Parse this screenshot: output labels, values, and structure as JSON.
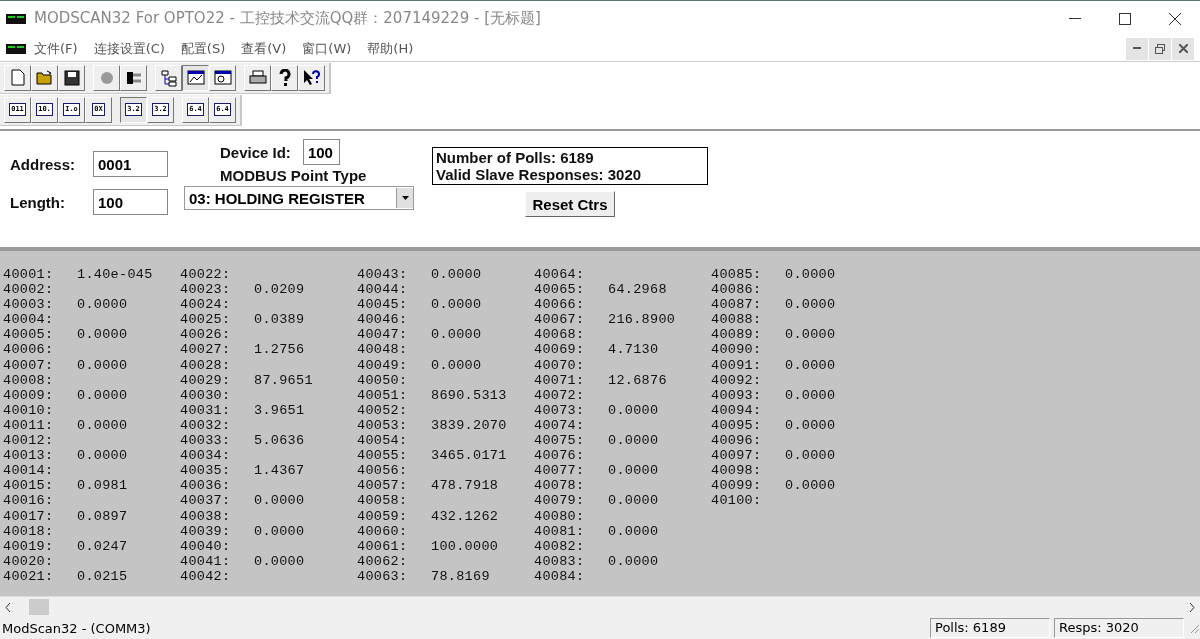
{
  "window": {
    "title": "MODSCAN32 For OPTO22 - 工控技术交流QQ群：207149229 - [无标题]"
  },
  "menu": [
    "文件(F)",
    "连接设置(C)",
    "配置(S)",
    "查看(V)",
    "窗口(W)",
    "帮助(H)"
  ],
  "toolbar": [
    [
      {
        "kind": "new",
        "pressed": false
      },
      {
        "kind": "open",
        "pressed": false
      },
      {
        "kind": "save",
        "pressed": false
      }
    ],
    [
      {
        "kind": "connect",
        "pressed": false
      },
      {
        "kind": "disconnect",
        "pressed": false
      }
    ],
    [
      {
        "kind": "tree",
        "pressed": false
      },
      {
        "kind": "chart",
        "pressed": true
      },
      {
        "kind": "display",
        "pressed": false
      }
    ],
    [
      {
        "kind": "print",
        "pressed": false
      },
      {
        "kind": "help",
        "pressed": false
      },
      {
        "kind": "context-help",
        "pressed": false
      }
    ]
  ],
  "format_bar": [
    [
      {
        "label": "011",
        "pressed": false
      },
      {
        "label": "10.",
        "pressed": false
      },
      {
        "label": "I.o",
        "pressed": false
      },
      {
        "label": "0X",
        "pressed": false
      }
    ],
    [
      {
        "label": "3.2",
        "pressed": true
      },
      {
        "label": "3.2",
        "pressed": false
      }
    ],
    [
      {
        "label": "6.4",
        "pressed": false
      },
      {
        "label": "6.4",
        "pressed": false
      }
    ]
  ],
  "form": {
    "address_label": "Address:",
    "address": "0001",
    "length_label": "Length:",
    "length": "100",
    "device_id_label": "Device Id:",
    "device_id": "100",
    "point_type_label": "MODBUS Point Type",
    "point_type": "03: HOLDING REGISTER",
    "polls": "Number of Polls: 6189",
    "responses": "Valid Slave Responses: 3020",
    "reset_button": "Reset Ctrs"
  },
  "registers": [
    {
      "address": "40001:",
      "value": "1.40e-045"
    },
    {
      "address": "40002:"
    },
    {
      "address": "40003:",
      "value": "0.0000"
    },
    {
      "address": "40004:"
    },
    {
      "address": "40005:",
      "value": "0.0000"
    },
    {
      "address": "40006:"
    },
    {
      "address": "40007:",
      "value": "0.0000"
    },
    {
      "address": "40008:"
    },
    {
      "address": "40009:",
      "value": "0.0000"
    },
    {
      "address": "40010:"
    },
    {
      "address": "40011:",
      "value": "0.0000"
    },
    {
      "address": "40012:"
    },
    {
      "address": "40013:",
      "value": "0.0000"
    },
    {
      "address": "40014:"
    },
    {
      "address": "40015:",
      "value": "0.0981"
    },
    {
      "address": "40016:"
    },
    {
      "address": "40017:",
      "value": "0.0897"
    },
    {
      "address": "40018:"
    },
    {
      "address": "40019:",
      "value": "0.0247"
    },
    {
      "address": "40020:"
    },
    {
      "address": "40021:",
      "value": "0.0215"
    },
    {
      "address": "40022:"
    },
    {
      "address": "40023:",
      "value": "0.0209"
    },
    {
      "address": "40024:"
    },
    {
      "address": "40025:",
      "value": "0.0389"
    },
    {
      "address": "40026:"
    },
    {
      "address": "40027:",
      "value": "1.2756"
    },
    {
      "address": "40028:"
    },
    {
      "address": "40029:",
      "value": "87.9651"
    },
    {
      "address": "40030:"
    },
    {
      "address": "40031:",
      "value": "3.9651"
    },
    {
      "address": "40032:"
    },
    {
      "address": "40033:",
      "value": "5.0636"
    },
    {
      "address": "40034:"
    },
    {
      "address": "40035:",
      "value": "1.4367"
    },
    {
      "address": "40036:"
    },
    {
      "address": "40037:",
      "value": "0.0000"
    },
    {
      "address": "40038:"
    },
    {
      "address": "40039:",
      "value": "0.0000"
    },
    {
      "address": "40040:"
    },
    {
      "address": "40041:",
      "value": "0.0000"
    },
    {
      "address": "40042:"
    },
    {
      "address": "40043:",
      "value": "0.0000"
    },
    {
      "address": "40044:"
    },
    {
      "address": "40045:",
      "value": "0.0000"
    },
    {
      "address": "40046:"
    },
    {
      "address": "40047:",
      "value": "0.0000"
    },
    {
      "address": "40048:"
    },
    {
      "address": "40049:",
      "value": "0.0000"
    },
    {
      "address": "40050:"
    },
    {
      "address": "40051:",
      "value": "8690.5313"
    },
    {
      "address": "40052:"
    },
    {
      "address": "40053:",
      "value": "3839.2070"
    },
    {
      "address": "40054:"
    },
    {
      "address": "40055:",
      "value": "3465.0171"
    },
    {
      "address": "40056:"
    },
    {
      "address": "40057:",
      "value": "478.7918"
    },
    {
      "address": "40058:"
    },
    {
      "address": "40059:",
      "value": "432.1262"
    },
    {
      "address": "40060:"
    },
    {
      "address": "40061:",
      "value": "100.0000"
    },
    {
      "address": "40062:"
    },
    {
      "address": "40063:",
      "value": "78.8169"
    },
    {
      "address": "40064:"
    },
    {
      "address": "40065:",
      "value": "64.2968"
    },
    {
      "address": "40066:"
    },
    {
      "address": "40067:",
      "value": "216.8900"
    },
    {
      "address": "40068:"
    },
    {
      "address": "40069:",
      "value": "4.7130"
    },
    {
      "address": "40070:"
    },
    {
      "address": "40071:",
      "value": "12.6876"
    },
    {
      "address": "40072:"
    },
    {
      "address": "40073:",
      "value": "0.0000"
    },
    {
      "address": "40074:"
    },
    {
      "address": "40075:",
      "value": "0.0000"
    },
    {
      "address": "40076:"
    },
    {
      "address": "40077:",
      "value": "0.0000"
    },
    {
      "address": "40078:"
    },
    {
      "address": "40079:",
      "value": "0.0000"
    },
    {
      "address": "40080:"
    },
    {
      "address": "40081:",
      "value": "0.0000"
    },
    {
      "address": "40082:"
    },
    {
      "address": "40083:",
      "value": "0.0000"
    },
    {
      "address": "40084:"
    },
    {
      "address": "40085:",
      "value": "0.0000"
    },
    {
      "address": "40086:"
    },
    {
      "address": "40087:",
      "value": "0.0000"
    },
    {
      "address": "40088:"
    },
    {
      "address": "40089:",
      "value": "0.0000"
    },
    {
      "address": "40090:"
    },
    {
      "address": "40091:",
      "value": "0.0000"
    },
    {
      "address": "40092:"
    },
    {
      "address": "40093:",
      "value": "0.0000"
    },
    {
      "address": "40094:"
    },
    {
      "address": "40095:",
      "value": "0.0000"
    },
    {
      "address": "40096:"
    },
    {
      "address": "40097:",
      "value": "0.0000"
    },
    {
      "address": "40098:"
    },
    {
      "address": "40099:",
      "value": "0.0000"
    },
    {
      "address": "40100:"
    }
  ],
  "status_bar": {
    "message": "ModScan32 - (COMM3)",
    "polls": "Polls: 6189",
    "responses": "Resps: 3020"
  }
}
